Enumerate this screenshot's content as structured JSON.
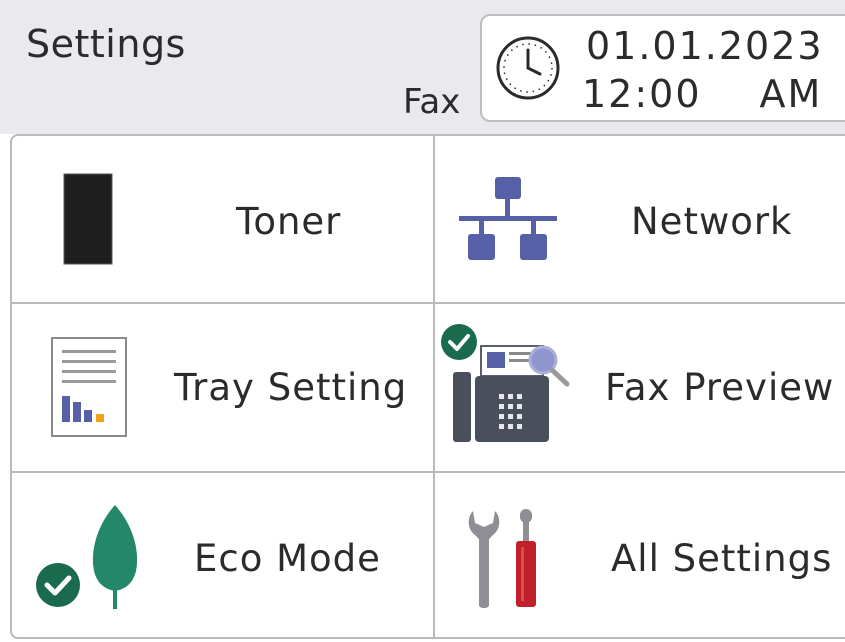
{
  "header": {
    "title": "Settings",
    "fax_label": "Fax",
    "date": "01.01.2023",
    "time": "12:00",
    "ampm": "AM"
  },
  "tiles": [
    {
      "label": "Toner",
      "icon": "toner-icon"
    },
    {
      "label": "Network",
      "icon": "network-icon"
    },
    {
      "label": "Tray Setting",
      "icon": "tray-setting-icon"
    },
    {
      "label": "Fax Preview",
      "icon": "fax-preview-icon",
      "checked": true
    },
    {
      "label": "Eco Mode",
      "icon": "eco-leaf-icon",
      "checked": true
    },
    {
      "label": "All Settings",
      "icon": "tools-icon"
    }
  ],
  "colors": {
    "header_bg": "#e9e9ee",
    "icon_blue": "#5560a6",
    "check_green": "#1a6a4e",
    "leaf_green": "#24876a",
    "screwdriver_red": "#c0202a"
  }
}
